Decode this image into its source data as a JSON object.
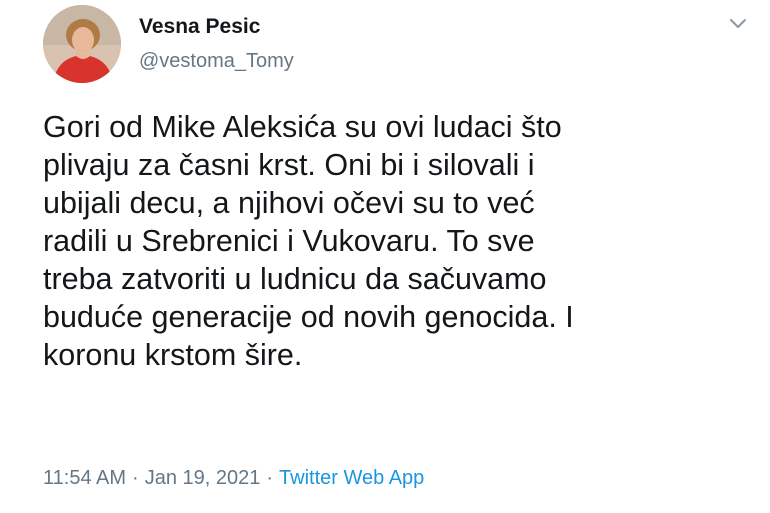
{
  "user": {
    "display_name": "Vesna Pesic",
    "handle": "@vestoma_Tomy",
    "avatar_icon": "profile-photo"
  },
  "menu": {
    "icon": "chevron-down-icon"
  },
  "tweet": {
    "lines": [
      "Gori od Mike Aleksića su ovi ludaci što",
      "plivaju za časni krst. Oni bi i silovali i",
      "ubijali decu, a njihovi očevi su to već",
      "radili u Srebrenici i Vukovaru. To sve",
      "treba zatvoriti u ludnicu da sačuvamo",
      "buduće generacije od novih genocida. I",
      "koronu krstom šire."
    ]
  },
  "meta": {
    "time": "11:54 AM",
    "separator": "·",
    "date": "Jan 19, 2021",
    "source": "Twitter Web App"
  },
  "colors": {
    "text": "#14171a",
    "secondary": "#657786",
    "link": "#1b95e0"
  }
}
